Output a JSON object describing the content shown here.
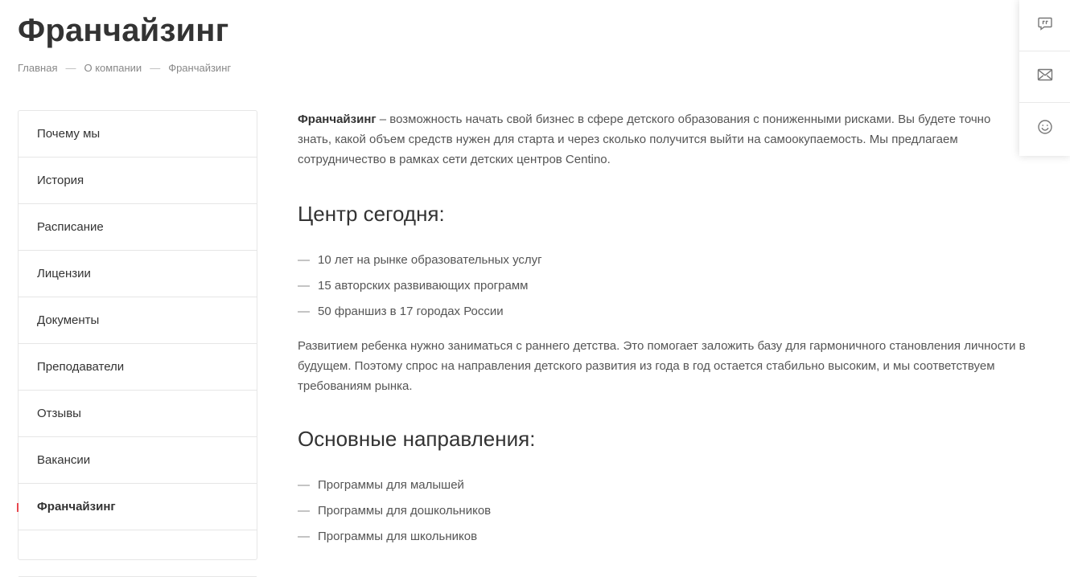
{
  "page": {
    "title": "Франчайзинг"
  },
  "breadcrumb": {
    "items": [
      "Главная",
      "О компании",
      "Франчайзинг"
    ],
    "separator": "—"
  },
  "sidebar": {
    "items": [
      {
        "label": "Почему мы"
      },
      {
        "label": "История"
      },
      {
        "label": "Расписание"
      },
      {
        "label": "Лицензии"
      },
      {
        "label": "Документы"
      },
      {
        "label": "Преподаватели"
      },
      {
        "label": "Отзывы"
      },
      {
        "label": "Вакансии"
      },
      {
        "label": "Франчайзинг",
        "active": true
      }
    ],
    "active_marker_color": "#e8474f"
  },
  "content": {
    "intro_bold": "Франчайзинг",
    "intro_text": " – возможность начать свой бизнес в сфере детского образования с пониженными рисками. Вы будете точно знать, какой объем средств нужен для старта и через сколько получится выйти на самоокупаемость. Мы предлагаем сотрудничество в рамках сети детских центров Centino.",
    "section1_title": "Центр сегодня:",
    "section1_items": [
      "10 лет на рынке образовательных услуг",
      "15 авторских развивающих программ",
      "50 франшиз в 17 городах России"
    ],
    "paragraph2": "Развитием ребенка нужно заниматься с раннего детства. Это помогает заложить базу для гармоничного становления личности в будущем. Поэтому спрос на направления детского развития из года в год остается стабильно высоким, и мы соответствуем требованиям рынка.",
    "section2_title": "Основные направления:",
    "section2_items": [
      "Программы для малышей",
      "Программы для дошкольников",
      "Программы для школьников"
    ],
    "list_dash": "—"
  },
  "float_panel": {
    "icons": [
      "chat-quote-icon",
      "mail-icon",
      "smile-icon"
    ]
  }
}
